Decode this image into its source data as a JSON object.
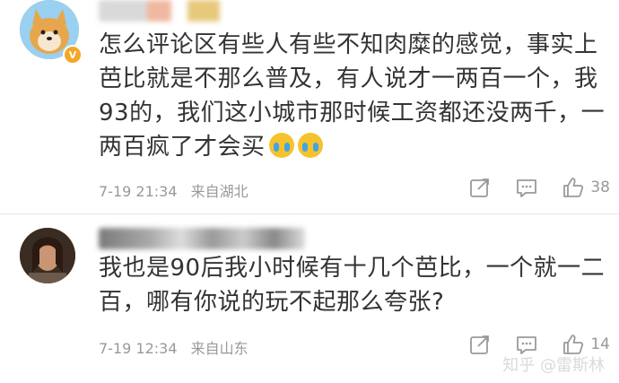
{
  "comments": [
    {
      "text": "怎么评论区有些人有些不知肉糜的感觉，事实上芭比就是不那么普及，有人说才一两百一个，我93的，我们这小城市那时候工资都还没两千，一两百疯了才会买",
      "emoji_icons": [
        "crying-face-icon",
        "crying-face-icon"
      ],
      "date": "7-19 21:34",
      "location": "来自湖北",
      "likes": "38"
    },
    {
      "text": "我也是90后我小时候有十几个芭比，一个就一二百，哪有你说的玩不起那么夸张?",
      "date": "7-19 12:34",
      "location": "来自山东",
      "likes": "14"
    }
  ],
  "watermark": "知乎 @雷斯林"
}
